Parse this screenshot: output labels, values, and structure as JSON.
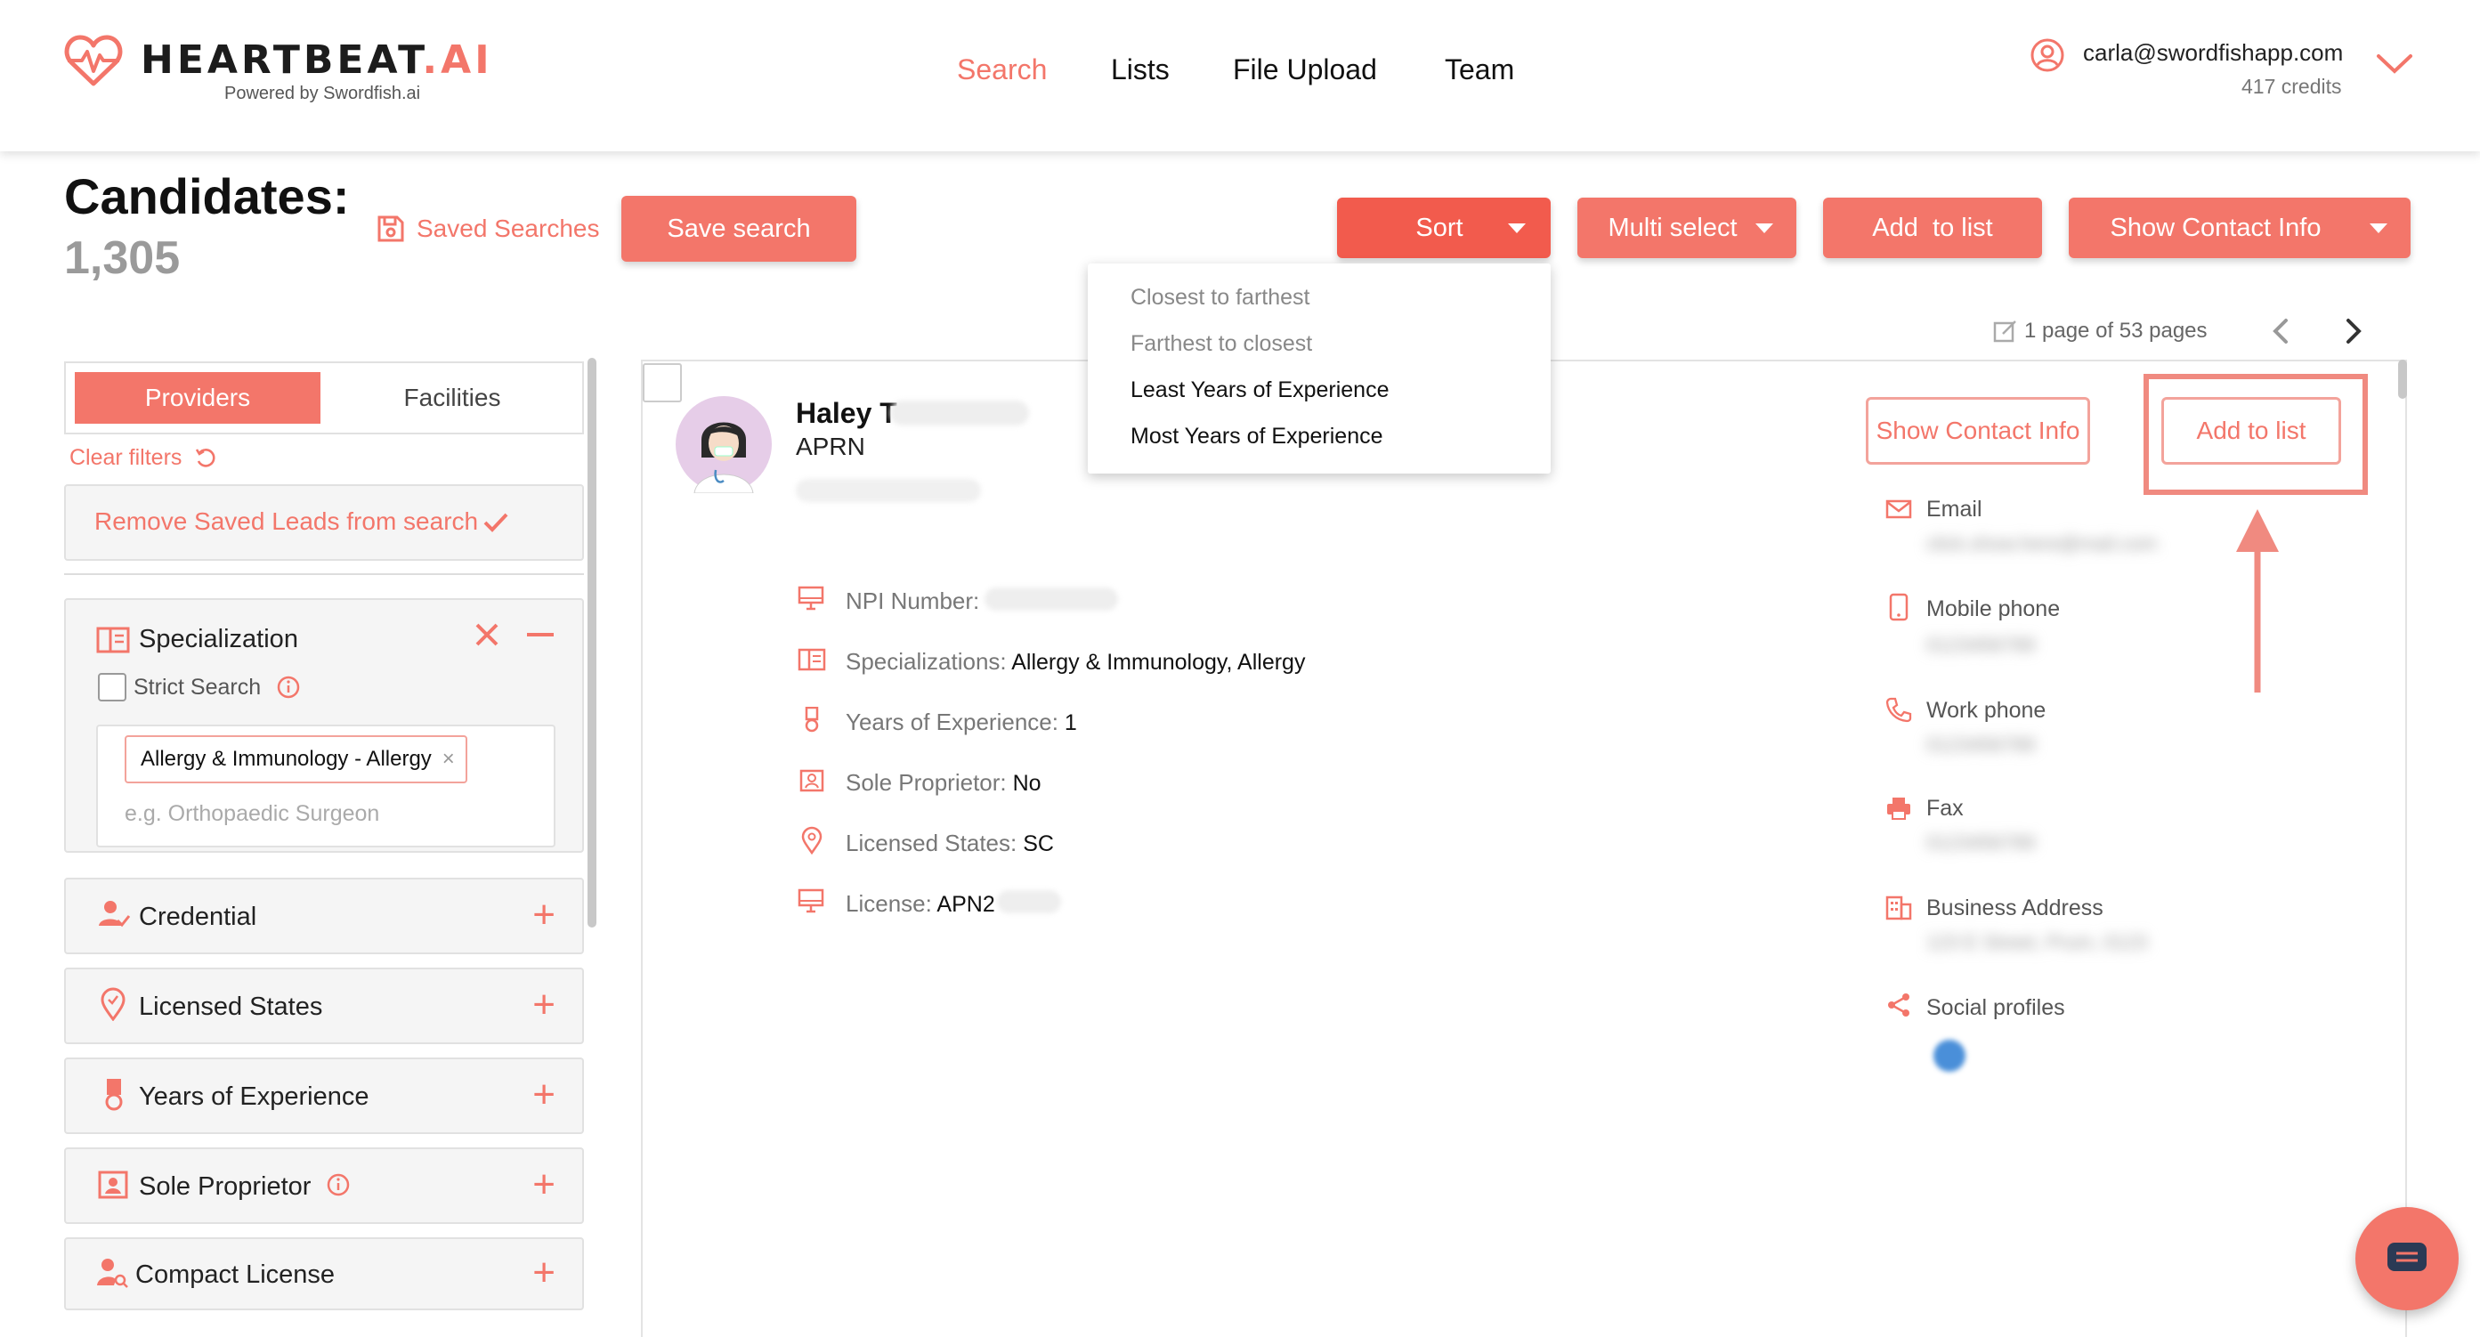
{
  "brand": {
    "name_main": "HEARTBEAT",
    "name_suffix": ".AI",
    "powered_by": "Powered by Swordfish.ai"
  },
  "nav": {
    "items": [
      {
        "label": "Search",
        "active": true
      },
      {
        "label": "Lists",
        "active": false
      },
      {
        "label": "File Upload",
        "active": false
      },
      {
        "label": "Team",
        "active": false
      }
    ]
  },
  "account": {
    "email": "carla@swordfishapp.com",
    "credits": "417 credits"
  },
  "toolbar": {
    "heading": "Candidates:",
    "count": "1,305",
    "saved_searches": "Saved Searches",
    "save_search": "Save search",
    "sort": "Sort",
    "multi_select": "Multi select",
    "add_to_list": "Add  to list",
    "show_contact_info": "Show Contact Info"
  },
  "sort_menu": {
    "options": [
      "Closest to farthest",
      "Farthest to closest",
      "Least Years of Experience",
      "Most Years of Experience"
    ]
  },
  "pagination": {
    "text": "1 page of 53 pages"
  },
  "sidebar": {
    "tab_providers": "Providers",
    "tab_facilities": "Facilities",
    "clear_filters": "Clear filters",
    "remove_saved": "Remove Saved Leads from search",
    "specialization": {
      "title": "Specialization",
      "strict_search": "Strict Search",
      "tag": "Allergy & Immunology - Allergy",
      "placeholder": "e.g. Orthopaedic Surgeon"
    },
    "filters": [
      "Credential",
      "Licensed States",
      "Years of Experience",
      "Sole Proprietor",
      "Compact License"
    ]
  },
  "candidate": {
    "name": "Haley T",
    "credential": "APRN",
    "show_contact_info": "Show Contact Info",
    "add_to_list": "Add to list",
    "details": [
      {
        "label": "NPI Number:",
        "value": ""
      },
      {
        "label": "Specializations:",
        "value": "Allergy & Immunology, Allergy"
      },
      {
        "label": "Years of Experience:",
        "value": "1"
      },
      {
        "label": "Sole Proprietor:",
        "value": "No"
      },
      {
        "label": "Licensed States:",
        "value": "SC"
      },
      {
        "label": "License:",
        "value": "APN2"
      }
    ],
    "contact": [
      {
        "label": "Email",
        "value": "click.show.here@mail.com"
      },
      {
        "label": "Mobile phone",
        "value": "0123456789"
      },
      {
        "label": "Work phone",
        "value": "0123456789"
      },
      {
        "label": "Fax",
        "value": "0123456789"
      },
      {
        "label": "Business Address",
        "value": "123 E Street, Prum, 0123"
      },
      {
        "label": "Social profiles",
        "value": ""
      }
    ]
  },
  "colors": {
    "accent": "#f3766a",
    "accent_dark": "#f25b4d",
    "highlight": "#f08a80"
  }
}
